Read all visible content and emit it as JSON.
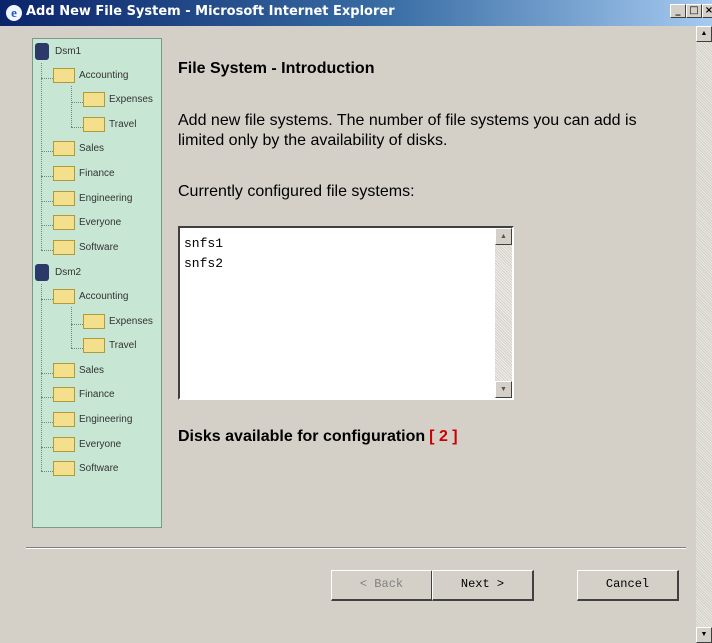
{
  "window": {
    "title": "Add New File System - Microsoft Internet Explorer",
    "minimize": "_",
    "maximize": "□",
    "close": "×"
  },
  "tree": {
    "roots": [
      {
        "label": "Dsm1",
        "children": [
          {
            "label": "Accounting",
            "children": [
              {
                "label": "Expenses"
              },
              {
                "label": "Travel"
              }
            ]
          },
          {
            "label": "Sales"
          },
          {
            "label": "Finance"
          },
          {
            "label": "Engineering"
          },
          {
            "label": "Everyone"
          },
          {
            "label": "Software"
          }
        ]
      },
      {
        "label": "Dsm2",
        "children": [
          {
            "label": "Accounting",
            "children": [
              {
                "label": "Expenses"
              },
              {
                "label": "Travel"
              }
            ]
          },
          {
            "label": "Sales"
          },
          {
            "label": "Finance"
          },
          {
            "label": "Engineering"
          },
          {
            "label": "Everyone"
          },
          {
            "label": "Software"
          }
        ]
      }
    ]
  },
  "main": {
    "heading": "File System - Introduction",
    "description": "Add new file systems. The number of file systems you can add is limited only by the availability of disks.",
    "configured_label": "Currently configured file systems:",
    "file_systems": [
      "snfs1",
      "snfs2"
    ],
    "disks_label": "Disks available for configuration",
    "disks_count": "[ 2 ]"
  },
  "buttons": {
    "back": "< Back",
    "next": "Next >",
    "cancel": "Cancel"
  },
  "colors": {
    "titlebar": "#0a246a",
    "tree_bg": "#c8e6d4",
    "disk_count": "#cc0000"
  }
}
